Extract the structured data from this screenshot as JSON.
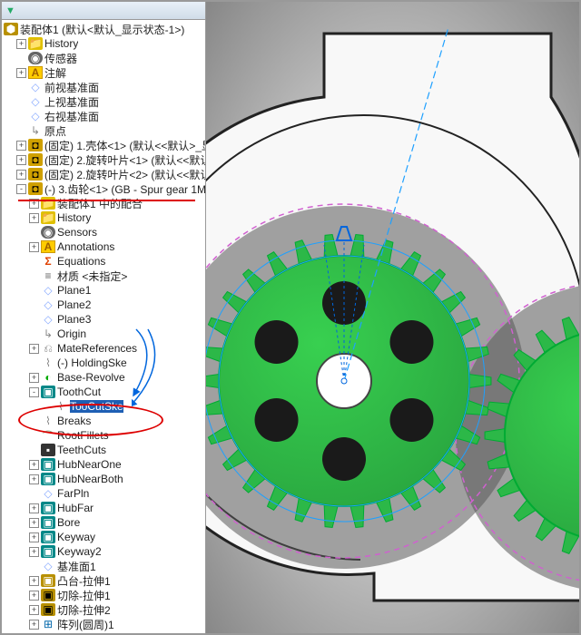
{
  "toolbar": {
    "filter": "▼"
  },
  "root": "装配体1  (默认<默认_显示状态-1>)",
  "tree": [
    {
      "ind": 1,
      "exp": "+",
      "icon": "fold-y",
      "label": "History"
    },
    {
      "ind": 1,
      "exp": "",
      "icon": "sensor",
      "label": "传感器"
    },
    {
      "ind": 1,
      "exp": "+",
      "icon": "A",
      "label": "注解"
    },
    {
      "ind": 1,
      "exp": "",
      "icon": "plane",
      "label": "前视基准面"
    },
    {
      "ind": 1,
      "exp": "",
      "icon": "plane",
      "label": "上视基准面"
    },
    {
      "ind": 1,
      "exp": "",
      "icon": "plane",
      "label": "右视基准面"
    },
    {
      "ind": 1,
      "exp": "",
      "icon": "origin",
      "label": "原点"
    },
    {
      "ind": 1,
      "exp": "+",
      "icon": "part-y",
      "label": "(固定) 1.壳体<1> (默认<<默认>_显"
    },
    {
      "ind": 1,
      "exp": "+",
      "icon": "part-y",
      "label": "(固定) 2.旋转叶片<1> (默认<<默认"
    },
    {
      "ind": 1,
      "exp": "+",
      "icon": "part-y",
      "label": "(固定) 2.旋转叶片<2> (默认<<默认"
    },
    {
      "ind": 1,
      "exp": "-",
      "icon": "part-y",
      "label": "(-) 3.齿轮<1> (GB - Spur gear 1M"
    },
    {
      "ind": 2,
      "exp": "+",
      "icon": "fold-y",
      "label": "装配体1 中的配合"
    },
    {
      "ind": 2,
      "exp": "+",
      "icon": "fold-y",
      "label": "History"
    },
    {
      "ind": 2,
      "exp": "",
      "icon": "sensor",
      "label": "Sensors"
    },
    {
      "ind": 2,
      "exp": "+",
      "icon": "A",
      "label": "Annotations"
    },
    {
      "ind": 2,
      "exp": "",
      "icon": "eq",
      "label": "Equations"
    },
    {
      "ind": 2,
      "exp": "",
      "icon": "mat",
      "label": "材质 <未指定>"
    },
    {
      "ind": 2,
      "exp": "",
      "icon": "plane",
      "label": "Plane1"
    },
    {
      "ind": 2,
      "exp": "",
      "icon": "plane",
      "label": "Plane2"
    },
    {
      "ind": 2,
      "exp": "",
      "icon": "plane",
      "label": "Plane3"
    },
    {
      "ind": 2,
      "exp": "",
      "icon": "origin",
      "label": "Origin"
    },
    {
      "ind": 2,
      "exp": "+",
      "icon": "ref",
      "label": "MateReferences"
    },
    {
      "ind": 2,
      "exp": "",
      "icon": "sketch",
      "label": "(-) HoldingSke"
    },
    {
      "ind": 2,
      "exp": "+",
      "icon": "revolve",
      "label": "Base-Revolve"
    },
    {
      "ind": 2,
      "exp": "-",
      "icon": "cut",
      "label": "ToothCut"
    },
    {
      "ind": 3,
      "exp": "",
      "icon": "sketch",
      "label": "TooCutSke",
      "sel": true
    },
    {
      "ind": 2,
      "exp": "",
      "icon": "sketch",
      "label": "Breaks"
    },
    {
      "ind": 2,
      "exp": "",
      "icon": "fillet-g",
      "label": "RootFillets"
    },
    {
      "ind": 2,
      "exp": "",
      "icon": "feat-blk",
      "label": "TeethCuts"
    },
    {
      "ind": 2,
      "exp": "+",
      "icon": "feat-g",
      "label": "HubNearOne"
    },
    {
      "ind": 2,
      "exp": "+",
      "icon": "feat-g",
      "label": "HubNearBoth"
    },
    {
      "ind": 2,
      "exp": "",
      "icon": "plane",
      "label": "FarPln"
    },
    {
      "ind": 2,
      "exp": "+",
      "icon": "feat-g",
      "label": "HubFar"
    },
    {
      "ind": 2,
      "exp": "+",
      "icon": "cut",
      "label": "Bore"
    },
    {
      "ind": 2,
      "exp": "+",
      "icon": "cut",
      "label": "Keyway"
    },
    {
      "ind": 2,
      "exp": "+",
      "icon": "cut",
      "label": "Keyway2"
    },
    {
      "ind": 2,
      "exp": "",
      "icon": "plane",
      "label": "基准面1"
    },
    {
      "ind": 2,
      "exp": "+",
      "icon": "ext",
      "label": "凸台-拉伸1"
    },
    {
      "ind": 2,
      "exp": "+",
      "icon": "extcut",
      "label": "切除-拉伸1"
    },
    {
      "ind": 2,
      "exp": "+",
      "icon": "extcut",
      "label": "切除-拉伸2"
    },
    {
      "ind": 2,
      "exp": "+",
      "icon": "pat",
      "label": "阵列(圆周)1"
    }
  ],
  "icons": {
    "asm": "⬢",
    "fold-y": "📁",
    "A": "A",
    "sensor": "◉",
    "plane": "◇",
    "origin": "↳",
    "part-y": "◘",
    "eq": "Σ",
    "mat": "≡",
    "sketch": "⌇",
    "revolve": "◐",
    "cut": "▣",
    "feat-g": "▣",
    "fillet-g": "⌒",
    "feat-blk": "▪",
    "ext": "▣",
    "extcut": "▣",
    "pat": "⊞",
    "ref": "⎌"
  }
}
